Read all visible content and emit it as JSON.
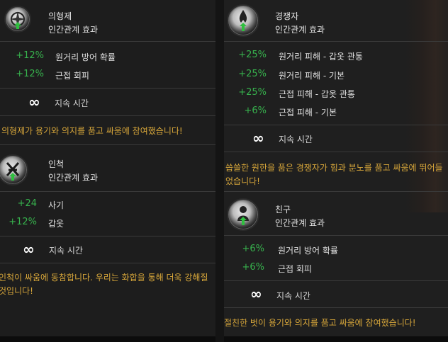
{
  "cards": [
    {
      "name": "의형제",
      "effect_type": "인간관계 효과",
      "icon": "compass-emblem-icon",
      "stats": [
        {
          "value": "+12%",
          "label": "원거리 방어 확률"
        },
        {
          "value": "+12%",
          "label": "근접 회피"
        }
      ],
      "duration_symbol": "∞",
      "duration_label": "지속 시간",
      "flavor": "의형제가 용기와 의지를 품고 싸움에 참여했습니다!"
    },
    {
      "name": "인척",
      "effect_type": "인간관계 효과",
      "icon": "rune-emblem-icon",
      "stats": [
        {
          "value": "+24",
          "label": "사기"
        },
        {
          "value": "+12%",
          "label": "갑옷"
        }
      ],
      "duration_symbol": "∞",
      "duration_label": "지속 시간",
      "flavor": "인척이 싸움에 동참합니다. 우리는 화합을 통해 더욱 강해질 것입니다!"
    },
    {
      "name": "경쟁자",
      "effect_type": "인간관계 효과",
      "icon": "flame-emblem-icon",
      "stats": [
        {
          "value": "+25%",
          "label": "원거리 피해 - 갑옷 관통"
        },
        {
          "value": "+25%",
          "label": "원거리 피해 - 기본"
        },
        {
          "value": "+25%",
          "label": "근접 피해 - 갑옷 관통"
        },
        {
          "value": "+6%",
          "label": "근접 피해 - 기본"
        }
      ],
      "duration_symbol": "∞",
      "duration_label": "지속 시간",
      "flavor": "씁쓸한 원한을 품은 경쟁자가 힘과 분노를 품고 싸움에 뛰어들었습니다!"
    },
    {
      "name": "친구",
      "effect_type": "인간관계 효과",
      "icon": "companion-emblem-icon",
      "stats": [
        {
          "value": "+6%",
          "label": "원거리 방어 확률"
        },
        {
          "value": "+6%",
          "label": "근접 회피"
        }
      ],
      "duration_symbol": "∞",
      "duration_label": "지속 시간",
      "flavor": "절친한 벗이 용기와 의지를 품고 싸움에 참여했습니다!"
    }
  ],
  "colors": {
    "bonus_green": "#37b24d",
    "flavor_gold": "#d8a73a",
    "panel_bg": "#1d1d1d",
    "separator": "#3a3a3a"
  }
}
